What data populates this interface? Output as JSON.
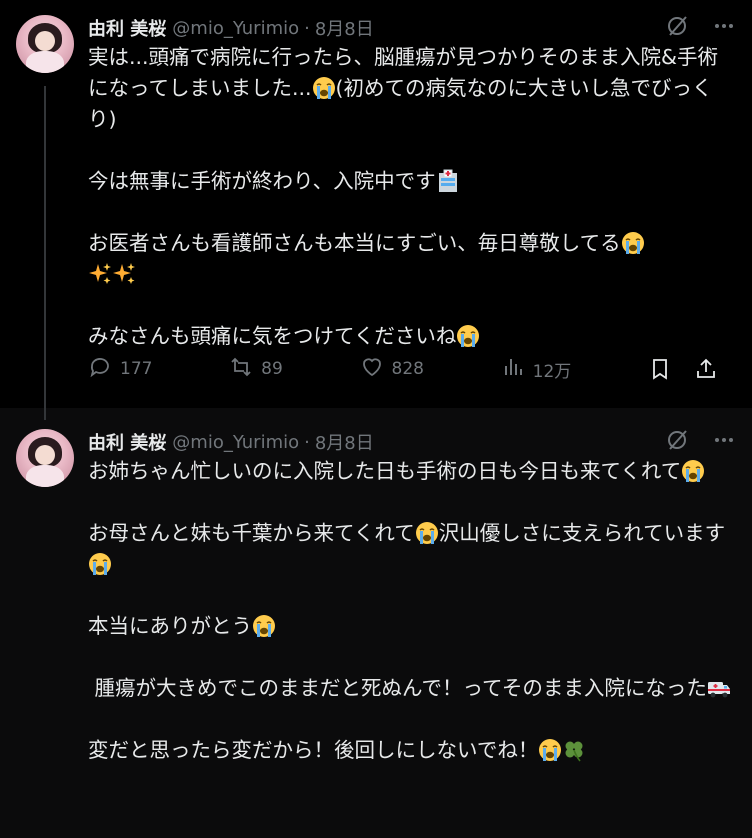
{
  "tweets": [
    {
      "author_name": "由利 美桜",
      "handle": "@mio_Yurimio",
      "separator": "·",
      "date": "8月8日",
      "segments": [
        {
          "t": "実は...頭痛で病院に行ったら、脳腫瘍が見つかりそのまま入院&手術になってしまいました..."
        },
        {
          "emoji": "loudly-crying-face"
        },
        {
          "t": "(初めての病気なのに大きいし急でびっくり)\n\n今は無事に手術が終わり、入院中です"
        },
        {
          "emoji": "hospital"
        },
        {
          "t": "\n\nお医者さんも看護師さんも本当にすごい、毎日尊敬してる"
        },
        {
          "emoji": "loudly-crying-face"
        },
        {
          "t": "\n"
        },
        {
          "emoji": "sparkles"
        },
        {
          "emoji": "sparkles"
        },
        {
          "t": "\n\nみなさんも頭痛に気をつけてくださいね"
        },
        {
          "emoji": "loudly-crying-face"
        }
      ],
      "actions": {
        "replies": "177",
        "reposts": "89",
        "likes": "828",
        "views": "12万"
      }
    },
    {
      "author_name": "由利 美桜",
      "handle": "@mio_Yurimio",
      "separator": "·",
      "date": "8月8日",
      "segments": [
        {
          "t": "お姉ちゃん忙しいのに入院した日も手術の日も今日も来てくれて"
        },
        {
          "emoji": "loudly-crying-face"
        },
        {
          "t": "\n\nお母さんと妹も千葉から来てくれて"
        },
        {
          "emoji": "loudly-crying-face"
        },
        {
          "t": "沢山優しさに支えられています"
        },
        {
          "emoji": "loudly-crying-face"
        },
        {
          "t": "\n\n本当にありがとう"
        },
        {
          "emoji": "loudly-crying-face"
        },
        {
          "t": "\n\n 腫瘍が大きめでこのままだと死ぬんで！ってそのまま入院になった"
        },
        {
          "emoji": "ambulance"
        },
        {
          "t": "\n\n変だと思ったら変だから！後回しにしないでね！"
        },
        {
          "emoji": "loudly-crying-face"
        },
        {
          "emoji": "four-leaf-clover"
        }
      ]
    }
  ],
  "colors": {
    "background": "#000000",
    "text": "#e7e9ea",
    "secondary": "#71767b",
    "thread_line": "#333639"
  },
  "icons": {
    "header": [
      "grok-icon",
      "more-icon"
    ],
    "actions": [
      "reply-icon",
      "repost-icon",
      "like-icon",
      "views-icon",
      "bookmark-icon",
      "share-icon"
    ]
  }
}
